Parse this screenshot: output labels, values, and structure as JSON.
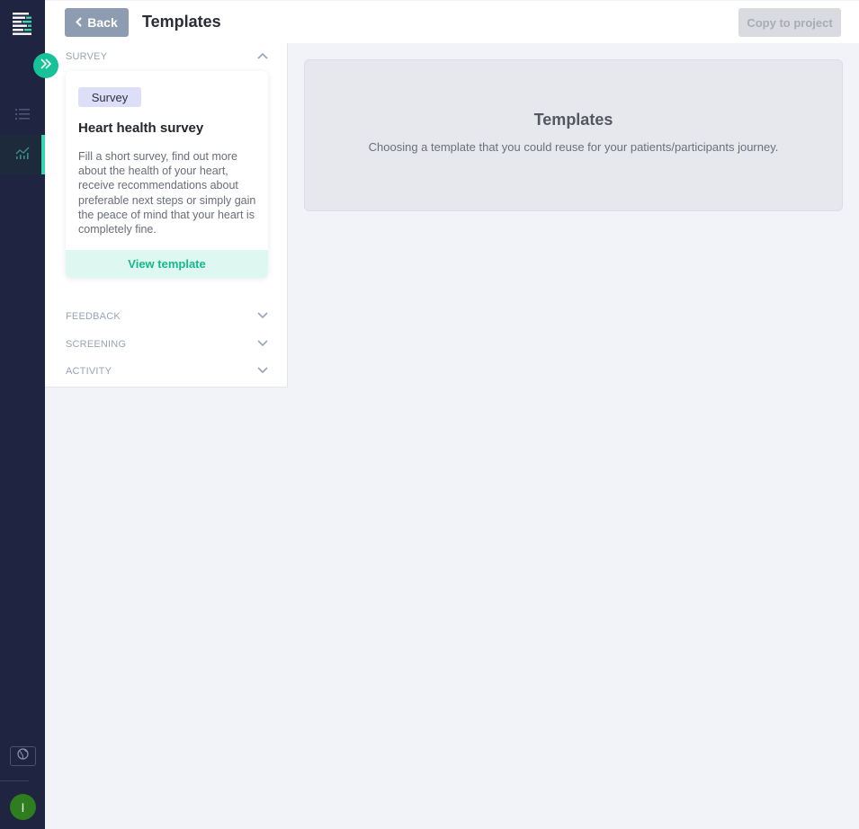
{
  "header": {
    "back_label": "Back",
    "title": "Templates",
    "copy_label": "Copy to project"
  },
  "sidebar": {
    "user_initial": "I"
  },
  "categories": [
    {
      "label": "SURVEY",
      "expanded": true
    },
    {
      "label": "FEEDBACK",
      "expanded": false
    },
    {
      "label": "SCREENING",
      "expanded": false
    },
    {
      "label": "ACTIVITY",
      "expanded": false
    }
  ],
  "card": {
    "tag": "Survey",
    "title": "Heart health survey",
    "description": "Fill a short survey, find out more about the health of your heart, receive recommendations about preferable next steps or simply gain the peace of mind that your heart is completely fine.",
    "action": "View template"
  },
  "info": {
    "title": "Templates",
    "subtitle": "Choosing a template that you could reuse for your patients/participants journey."
  },
  "colors": {
    "rail": "#1f2540",
    "accent": "#17c299",
    "avatar": "#2e7d1e"
  }
}
